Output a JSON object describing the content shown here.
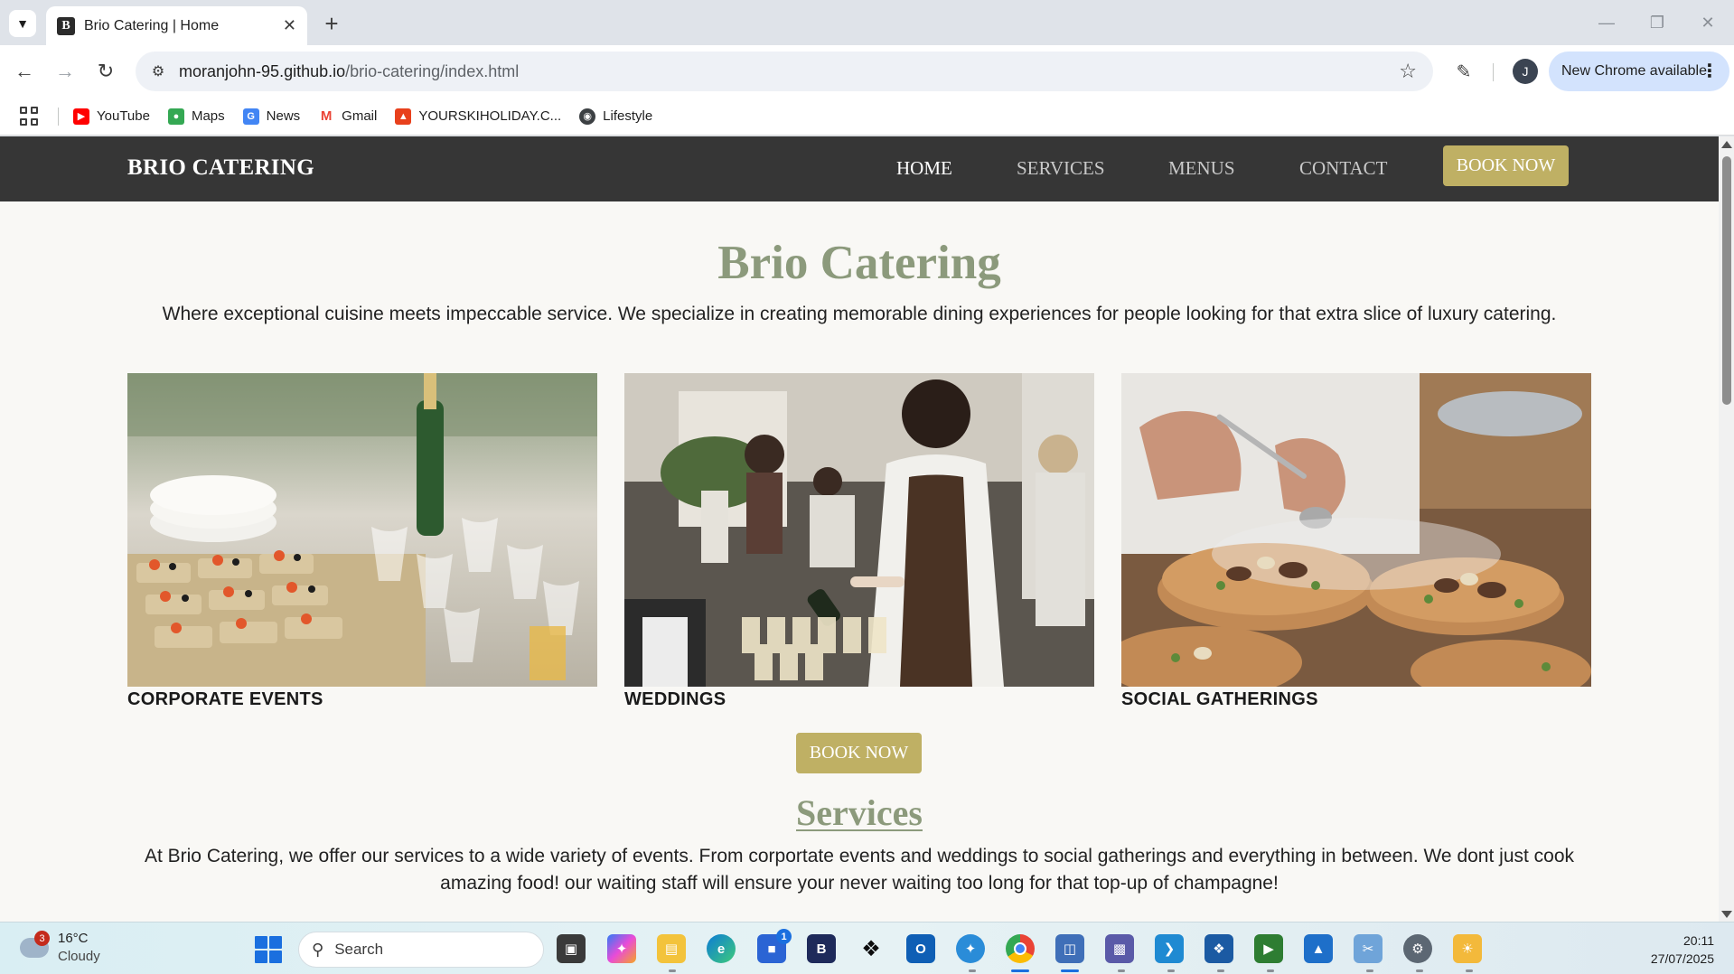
{
  "browser": {
    "tab_title": "Brio Catering | Home",
    "url_host": "moranjohn-95.github.io",
    "url_path": "/brio-catering/index.html",
    "new_chrome_label": "New Chrome available",
    "profile_initial": "J",
    "bookmarks": [
      {
        "label": "YouTube",
        "icon": "youtube-icon",
        "color": "#ff0000"
      },
      {
        "label": "Maps",
        "icon": "maps-icon",
        "color": "#34a853"
      },
      {
        "label": "News",
        "icon": "news-icon",
        "color": "#4285f4"
      },
      {
        "label": "Gmail",
        "icon": "gmail-icon",
        "color": "#ea4335"
      },
      {
        "label": "YOURSKIHOLIDAY.C...",
        "icon": "skiholiday-icon",
        "color": "#e8401c"
      },
      {
        "label": "Lifestyle",
        "icon": "globe-icon",
        "color": "#3c4043"
      }
    ]
  },
  "site": {
    "brand": "BRIO CATERING",
    "nav": {
      "home": "HOME",
      "services": "SERVICES",
      "menus": "MENUS",
      "contact": "CONTACT",
      "book_now": "BOOK NOW"
    },
    "hero": {
      "title": "Brio Catering",
      "text": "Where exceptional cuisine meets impeccable service. We specialize in creating memorable dining experiences for people looking for that extra slice of luxury catering."
    },
    "cards": [
      {
        "label": "CORPORATE EVENTS",
        "image": "corporate-events-photo"
      },
      {
        "label": "WEDDINGS",
        "image": "weddings-photo"
      },
      {
        "label": "SOCIAL GATHERINGS",
        "image": "social-gatherings-photo"
      }
    ],
    "book_now_button": "BOOK NOW",
    "services": {
      "title": "Services",
      "text": "At Brio Catering, we offer our services to a wide variety of events. From corportate events and weddings to social gatherings and everything in between. We dont just cook amazing food! our waiting staff will ensure your never waiting too long for that top-up of champagne!"
    },
    "colors": {
      "nav_bg": "#363636",
      "accent_gold": "#bfb064",
      "heading_green": "#8c9a7c",
      "page_bg": "#f9f8f5"
    }
  },
  "taskbar": {
    "weather_temp": "16°C",
    "weather_desc": "Cloudy",
    "weather_badge": "3",
    "search_placeholder": "Search",
    "time": "20:11",
    "date": "27/07/2025",
    "store_badge": "1"
  }
}
